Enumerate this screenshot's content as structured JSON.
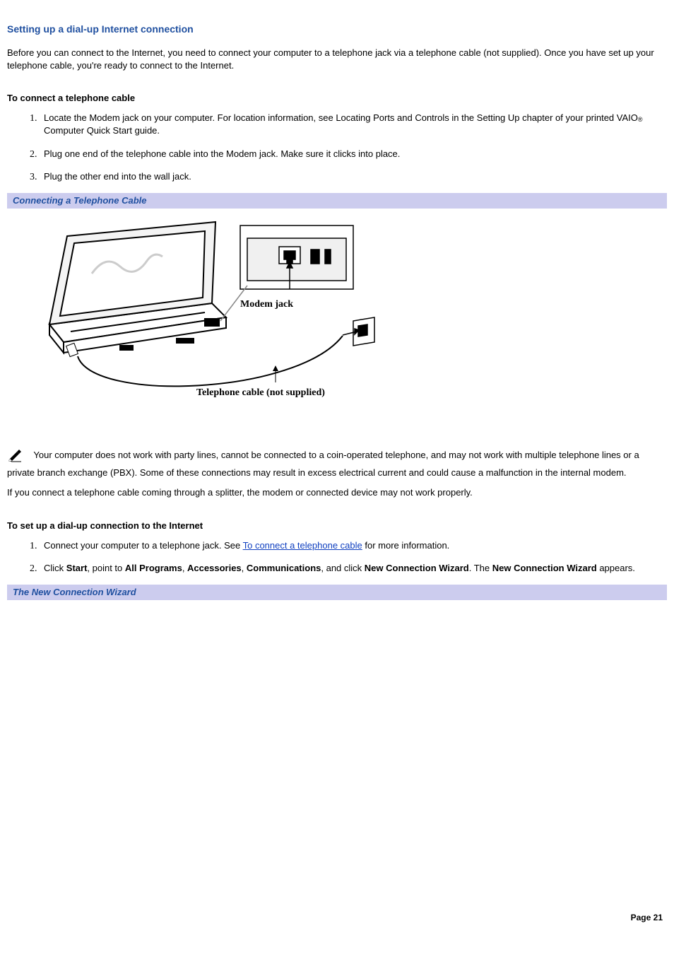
{
  "title": "Setting up a dial-up Internet connection",
  "intro": "Before you can connect to the Internet, you need to connect your computer to a telephone jack via a telephone cable (not supplied). Once you have set up your telephone cable, you're ready to connect to the Internet.",
  "section1_heading": "To connect a telephone cable",
  "steps1": {
    "s1a": "Locate the Modem jack on your computer. For location information, see Locating Ports and Controls in the Setting Up chapter of your printed VAIO",
    "s1b": " Computer Quick Start guide.",
    "reg": "®",
    "s2": "Plug one end of the telephone cable into the Modem jack. Make sure it clicks into place.",
    "s3": "Plug the other end into the wall jack."
  },
  "banner1": "Connecting a Telephone Cable",
  "figure": {
    "modem_label": "Modem jack",
    "cable_label": "Telephone cable (not supplied)"
  },
  "note_text": "Your computer does not work with party lines, cannot be connected to a coin-operated telephone, and may not work with multiple telephone lines or a private branch exchange (PBX). Some of these connections may result in excess electrical current and could cause a malfunction in the internal modem.",
  "splitter_text": "If you connect a telephone cable coming through a splitter, the modem or connected device may not work properly.",
  "section2_heading": "To set up a dial-up connection to the Internet",
  "steps2": {
    "s1a": "Connect your computer to a telephone jack. See ",
    "s1_link": "To connect a telephone cable",
    "s1b": " for more information.",
    "s2_parts": {
      "a": "Click ",
      "b": "Start",
      "c": ", point to ",
      "d": "All Programs",
      "e": ", ",
      "f": "Accessories",
      "g": ", ",
      "h": "Communications",
      "i": ", and click ",
      "j": "New Connection Wizard",
      "k": ". The ",
      "l": "New Connection Wizard",
      "m": " appears."
    }
  },
  "banner2": "The New Connection Wizard",
  "page_footer": "Page 21"
}
